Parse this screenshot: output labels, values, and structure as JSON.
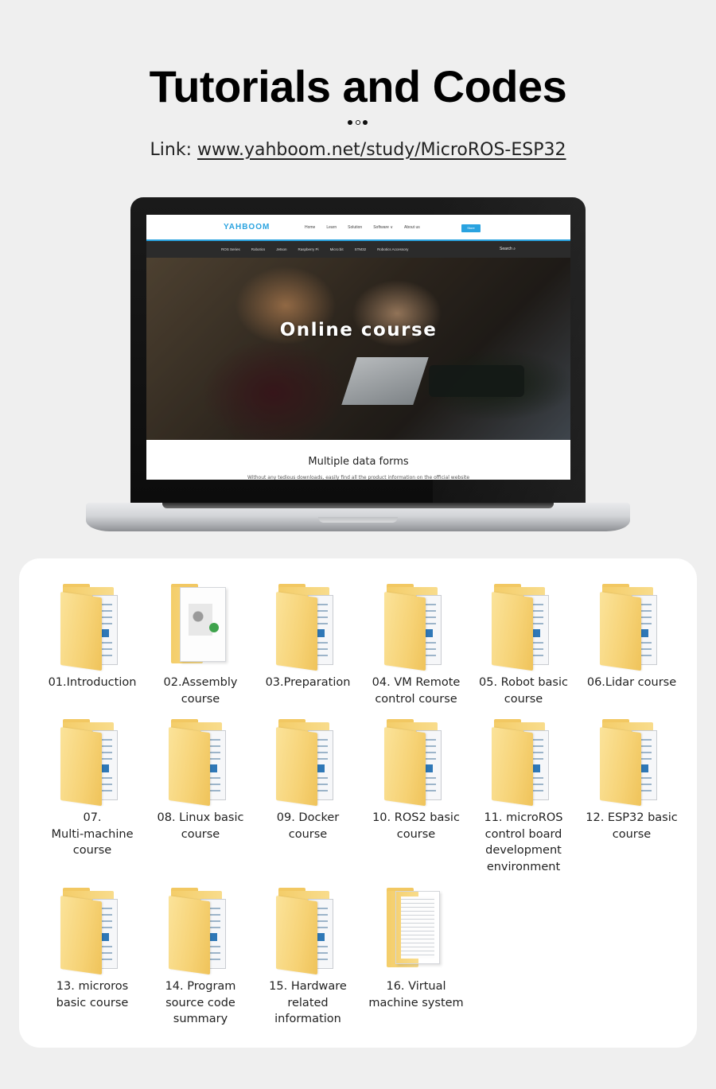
{
  "header": {
    "title": "Tutorials and Codes",
    "link_prefix": "Link:",
    "link_url": "www.yahboom.net/study/MicroROS-ESP32"
  },
  "laptop_screen": {
    "logo": "YAHBOOM",
    "nav": [
      "Home",
      "Learn",
      "Solution",
      "Software ∨",
      "About us"
    ],
    "store_button": "Store",
    "subnav": [
      "ROS Series",
      "Robotics",
      "Jetson",
      "Raspberry Pi",
      "Micro:bit",
      "STM32",
      "Robotics Accessory"
    ],
    "search": "Search ⌕",
    "hero_title": "Online course",
    "section_title": "Multiple data forms",
    "section_subtitle": "Without any tedious downloads, easily find all the product information on the official website"
  },
  "folders": [
    {
      "label": "01.Introduction",
      "kind": "folder"
    },
    {
      "label": "02.Assembly\ncourse",
      "kind": "document-assembly"
    },
    {
      "label": "03.Preparation",
      "kind": "folder"
    },
    {
      "label": "04. VM Remote\ncontrol course",
      "kind": "folder"
    },
    {
      "label": "05. Robot basic\ncourse",
      "kind": "folder"
    },
    {
      "label": "06.Lidar course",
      "kind": "folder"
    },
    {
      "label": "07.\nMulti-machine\ncourse",
      "kind": "folder"
    },
    {
      "label": "08. Linux basic\ncourse",
      "kind": "folder"
    },
    {
      "label": "09. Docker\ncourse",
      "kind": "folder"
    },
    {
      "label": "10. ROS2 basic\ncourse",
      "kind": "folder"
    },
    {
      "label": "11. microROS\ncontrol board\ndevelopment\nenvironment",
      "kind": "folder"
    },
    {
      "label": "12. ESP32 basic\ncourse",
      "kind": "folder"
    },
    {
      "label": "13. microros\nbasic course",
      "kind": "folder"
    },
    {
      "label": "14. Program\nsource code\nsummary",
      "kind": "folder"
    },
    {
      "label": "15. Hardware\nrelated\ninformation",
      "kind": "folder"
    },
    {
      "label": "16. Virtual\nmachine system",
      "kind": "document-lined"
    }
  ],
  "colors": {
    "background": "#efefef",
    "accent_blue": "#2aa3e0",
    "folder_yellow": "#f6d275"
  }
}
